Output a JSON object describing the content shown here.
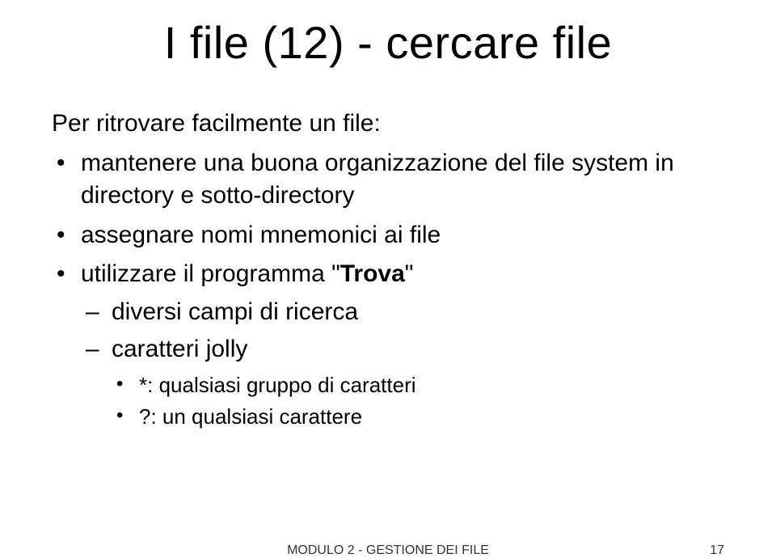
{
  "title": "I file (12) - cercare file",
  "intro": "Per ritrovare facilmente un file:",
  "bullets": [
    {
      "text": "mantenere una buona organizzazione del file system in directory e sotto-directory"
    },
    {
      "text": "assegnare nomi mnemonici ai file"
    },
    {
      "prefix": "utilizzare il programma \"",
      "bold": "Trova",
      "suffix": "\"",
      "sub": [
        {
          "text": "diversi campi di ricerca"
        },
        {
          "text": "caratteri jolly",
          "sub": [
            {
              "text": "*: qualsiasi gruppo di caratteri"
            },
            {
              "text": "?: un qualsiasi carattere"
            }
          ]
        }
      ]
    }
  ],
  "footer": {
    "center": "MODULO 2 - GESTIONE DEI FILE",
    "page": "17"
  }
}
